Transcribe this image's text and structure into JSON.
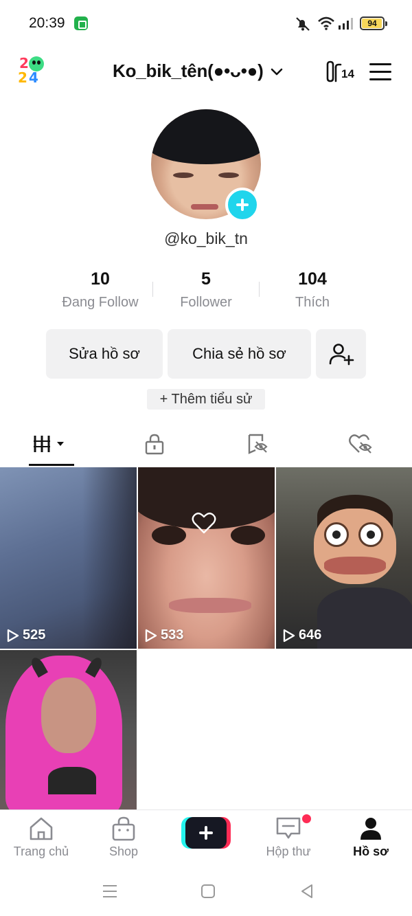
{
  "status_bar": {
    "time": "20:39",
    "battery": "94"
  },
  "header": {
    "username": "Ko_bik_tên(●•ᴗ•●)",
    "creator_badge": "14"
  },
  "profile": {
    "handle": "@ko_bik_tn"
  },
  "stats": [
    {
      "value": "10",
      "label": "Đang Follow"
    },
    {
      "value": "5",
      "label": "Follower"
    },
    {
      "value": "104",
      "label": "Thích"
    }
  ],
  "actions": {
    "edit": "Sửa hồ sơ",
    "share": "Chia sẻ hồ sơ",
    "add_bio": "+ Thêm tiểu sử"
  },
  "videos": [
    {
      "views": "525"
    },
    {
      "views": "533"
    },
    {
      "views": "646"
    },
    {
      "views": ""
    }
  ],
  "bottom_nav": {
    "home": "Trang chủ",
    "shop": "Shop",
    "inbox": "Hộp thư",
    "profile": "Hồ sơ"
  },
  "colors": {
    "accent_cyan": "#20d5ec",
    "accent_red": "#fe2c55",
    "text_primary": "#161823"
  }
}
